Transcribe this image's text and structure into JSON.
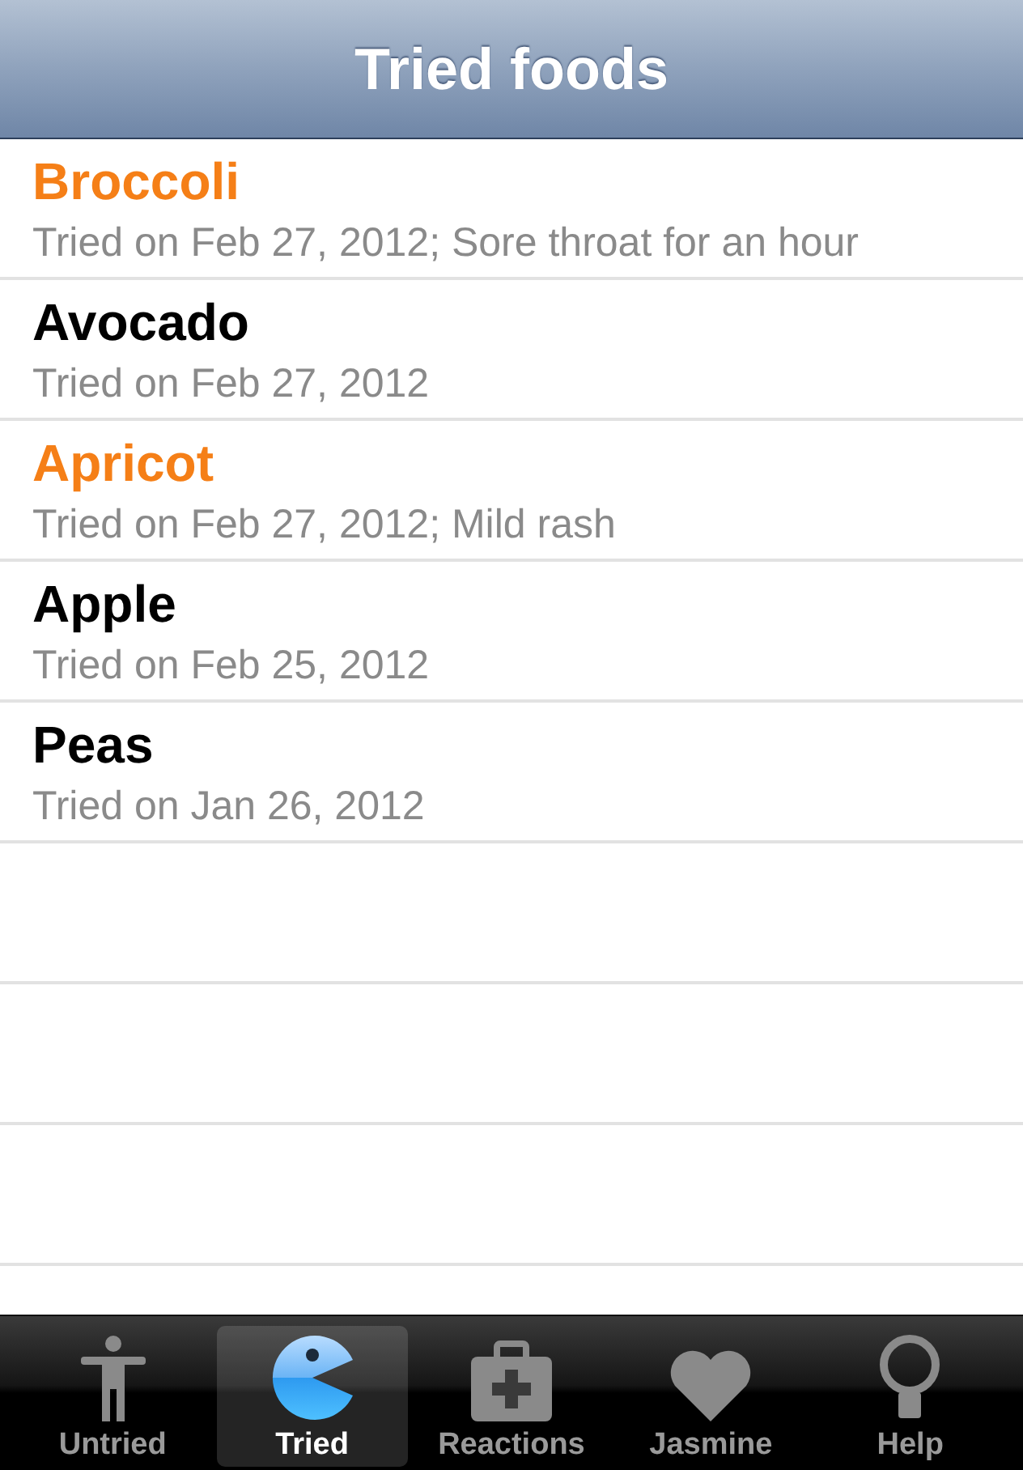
{
  "nav_bar": {
    "title": "Tried foods"
  },
  "foods": [
    {
      "name": "Broccoli",
      "detail": "Tried on Feb 27, 2012; Sore throat for an hour",
      "color": "#f57f17"
    },
    {
      "name": "Avocado",
      "detail": "Tried on Feb 27, 2012",
      "color": "#000000"
    },
    {
      "name": "Apricot",
      "detail": "Tried on Feb 27, 2012; Mild rash",
      "color": "#f57f17"
    },
    {
      "name": "Apple",
      "detail": "Tried on Feb 25, 2012",
      "color": "#000000"
    },
    {
      "name": "Peas",
      "detail": "Tried on Jan 26, 2012",
      "color": "#000000"
    }
  ],
  "tab_bar": [
    {
      "label": "Untried",
      "selected": false
    },
    {
      "label": "Tried",
      "selected": true
    },
    {
      "label": "Reactions",
      "selected": false
    },
    {
      "label": "Jasmine",
      "selected": false
    },
    {
      "label": "Help",
      "selected": false
    }
  ]
}
